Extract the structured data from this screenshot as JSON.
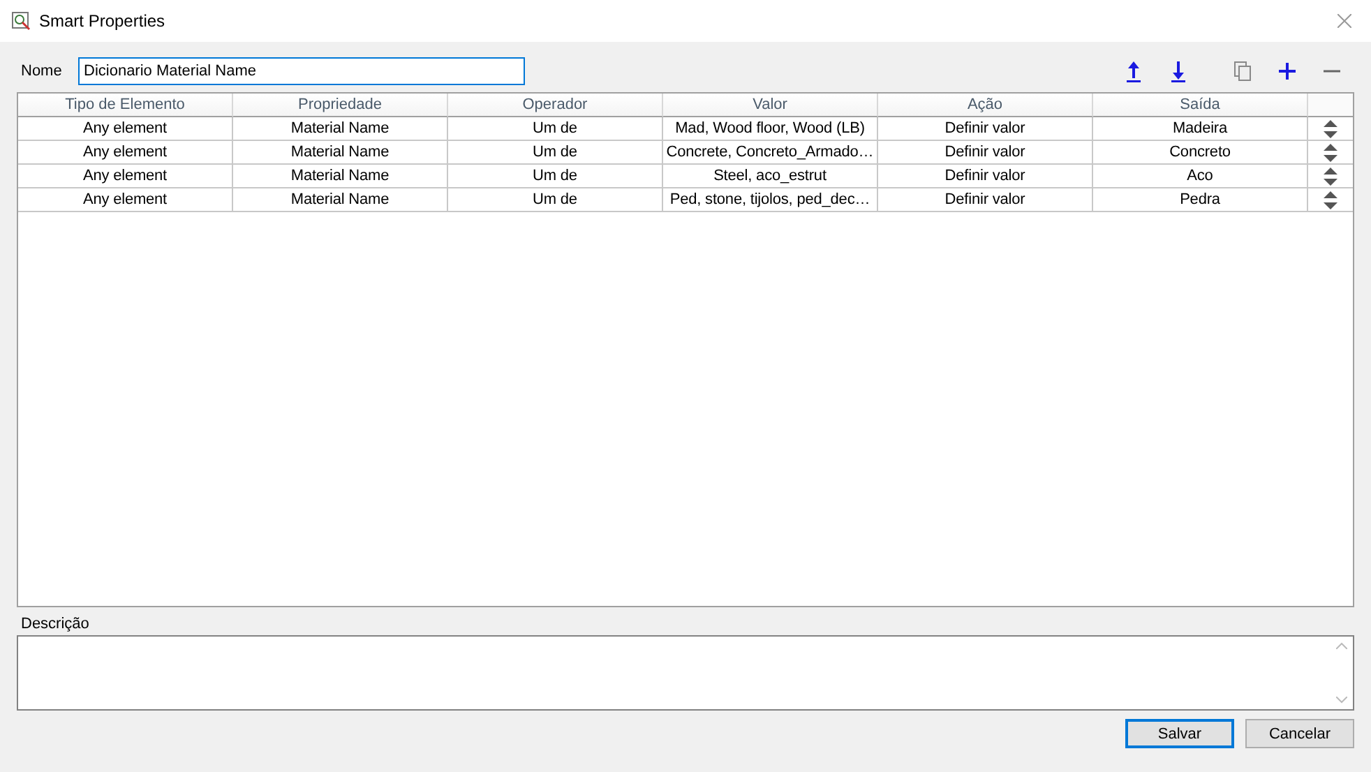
{
  "window": {
    "title": "Smart Properties"
  },
  "name_field": {
    "label": "Nome",
    "value": "Dicionario Material Name"
  },
  "table": {
    "columns": [
      "Tipo de Elemento",
      "Propriedade",
      "Operador",
      "Valor",
      "Ação",
      "Saída"
    ],
    "rows": [
      {
        "cells": [
          "Any element",
          "Material Name",
          "Um de",
          "Mad, Wood floor, Wood (LB)",
          "Definir valor",
          "Madeira"
        ]
      },
      {
        "cells": [
          "Any element",
          "Material Name",
          "Um de",
          "Concrete, Concreto_Armado…",
          "Definir valor",
          "Concreto"
        ]
      },
      {
        "cells": [
          "Any element",
          "Material Name",
          "Um de",
          "Steel, aco_estrut",
          "Definir valor",
          "Aco"
        ]
      },
      {
        "cells": [
          "Any element",
          "Material Name",
          "Um de",
          "Ped, stone, tijolos, ped_dec…",
          "Definir valor",
          "Pedra"
        ]
      }
    ]
  },
  "description": {
    "label": "Descrição"
  },
  "buttons": [
    {
      "label": "Salvar",
      "default": true
    },
    {
      "label": "Cancelar",
      "default": false
    }
  ]
}
